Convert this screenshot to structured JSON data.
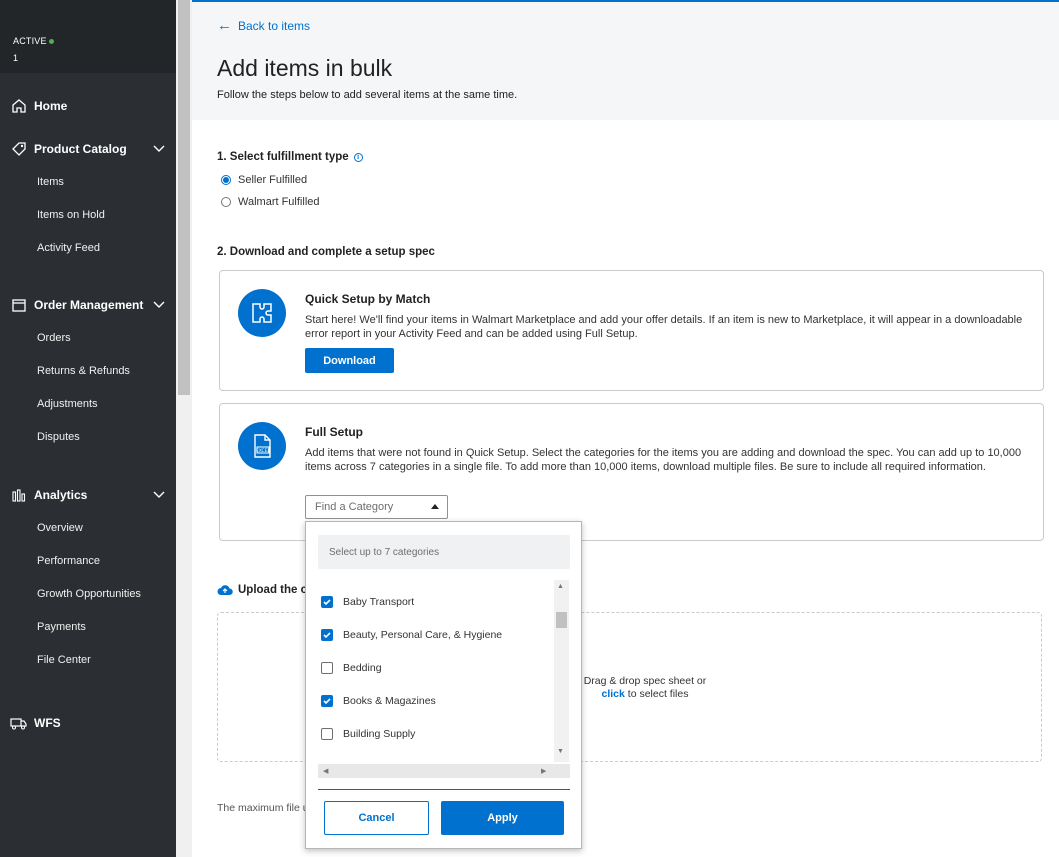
{
  "sidebar": {
    "status_label": "ACTIVE",
    "status_number": "1",
    "sections": [
      {
        "label": "Home",
        "icon": "home-icon"
      },
      {
        "label": "Product Catalog",
        "icon": "tag-icon",
        "items": [
          "Items",
          "Items on Hold",
          "Activity Feed"
        ]
      },
      {
        "label": "Order Management",
        "icon": "calendar-icon",
        "items": [
          "Orders",
          "Returns & Refunds",
          "Adjustments",
          "Disputes"
        ]
      },
      {
        "label": "Analytics",
        "icon": "bar-chart-icon",
        "items": [
          "Overview",
          "Performance",
          "Growth Opportunities",
          "Payments",
          "File Center"
        ]
      },
      {
        "label": "WFS",
        "icon": "truck-icon"
      }
    ]
  },
  "header": {
    "back_label": "Back to items",
    "title": "Add items in bulk",
    "subtitle": "Follow the steps below to add several items at the same time."
  },
  "step1": {
    "label": "1. Select fulfillment type",
    "options": [
      {
        "label": "Seller Fulfilled",
        "selected": true
      },
      {
        "label": "Walmart Fulfilled",
        "selected": false
      }
    ]
  },
  "step2": {
    "label": "2. Download and complete a setup spec",
    "quick": {
      "title": "Quick Setup by Match",
      "desc": "Start here! We'll find your items in Walmart Marketplace and add your offer details. If an item is new to Marketplace, it will appear in a downloadable error report in your Activity Feed and can be added using Full Setup.",
      "button": "Download"
    },
    "full": {
      "title": "Full Setup",
      "desc": "Add items that were not found in Quick Setup. Select the categories for the items you are adding and download the spec. You can add up to 10,000 items across 7 categories in a single file. To add more than 10,000 items, download multiple files. Be sure to include all required information.",
      "select_placeholder": "Find a Category",
      "icon_text": "EXCEL"
    }
  },
  "upload": {
    "title": "Upload the c",
    "drop_text": "Drag & drop spec sheet or",
    "click_text": "click",
    "after_click": " to select files",
    "max_file": "The maximum file u"
  },
  "dropdown": {
    "hint": "Select up to 7 categories",
    "options": [
      {
        "label": "Baby Transport",
        "checked": true
      },
      {
        "label": "Beauty, Personal Care, & Hygiene",
        "checked": true
      },
      {
        "label": "Bedding",
        "checked": false
      },
      {
        "label": "Books & Magazines",
        "checked": true
      },
      {
        "label": "Building Supply",
        "checked": false
      }
    ],
    "cancel": "Cancel",
    "apply": "Apply"
  },
  "colors": {
    "accent": "#0071ce",
    "sidebar": "#2b2e33",
    "active_dot": "#4caf50"
  }
}
